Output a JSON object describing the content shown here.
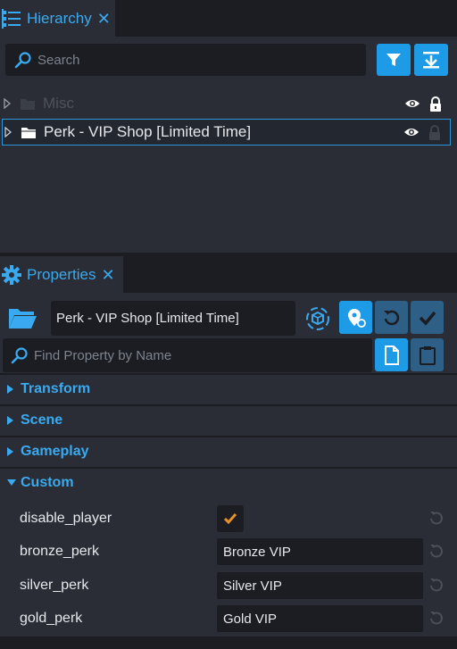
{
  "hierarchy": {
    "tab_title": "Hierarchy",
    "search_placeholder": "Search",
    "items": [
      {
        "label": "Misc",
        "dimmed": true
      },
      {
        "label": "Perk - VIP Shop [Limited Time]",
        "selected": true
      }
    ]
  },
  "properties": {
    "tab_title": "Properties",
    "object_name": "Perk - VIP Shop [Limited Time]",
    "find_placeholder": "Find Property by Name",
    "sections": [
      {
        "label": "Transform",
        "expanded": false
      },
      {
        "label": "Scene",
        "expanded": false
      },
      {
        "label": "Gameplay",
        "expanded": false
      },
      {
        "label": "Custom",
        "expanded": true
      }
    ],
    "custom_props": [
      {
        "name": "disable_player",
        "type": "bool",
        "checked": true
      },
      {
        "name": "bronze_perk",
        "type": "text",
        "value": "Bronze VIP"
      },
      {
        "name": "silver_perk",
        "type": "text",
        "value": "Silver VIP"
      },
      {
        "name": "gold_perk",
        "type": "text",
        "value": "Gold VIP"
      }
    ]
  },
  "colors": {
    "accent": "#3aaaf0",
    "button_blue": "#1e9be6",
    "button_dark": "#2d5f87",
    "panel_bg": "#2a2d35",
    "dark_bg": "#1b1d22",
    "check": "#e8912a"
  },
  "icons": [
    "list-icon",
    "close-icon",
    "search-icon",
    "filter-icon",
    "collapse-all-icon",
    "triangle-right-icon",
    "folder-icon",
    "eye-icon",
    "lock-icon",
    "gear-icon",
    "open-folder-icon",
    "cube-icon",
    "location-pin-icon",
    "undo-icon",
    "checkmark-icon",
    "document-icon",
    "clipboard-icon",
    "triangle-down-icon",
    "reset-icon"
  ]
}
